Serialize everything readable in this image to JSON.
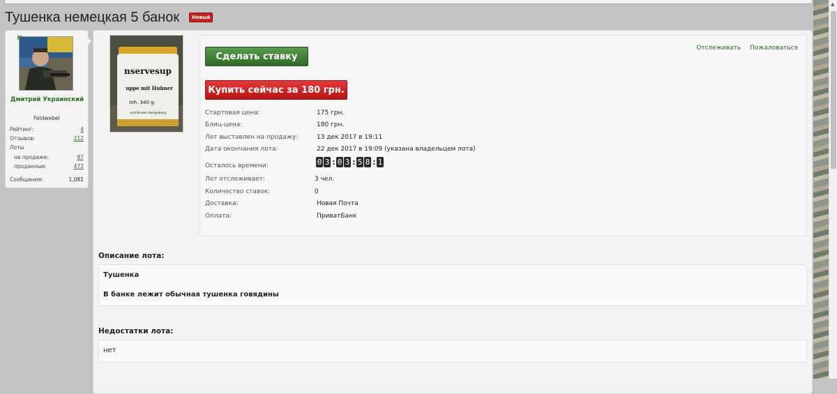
{
  "title": "Тушенка немецкая 5 банок",
  "badge": "Новый",
  "user": {
    "name": "Дмитрий Украинский",
    "rank": "Feldwebel",
    "stats": [
      {
        "label": "Рейтинг:",
        "value": "4"
      },
      {
        "label": "Отзывов:",
        "value": "212"
      },
      {
        "label": "Лоты",
        "value": ""
      },
      {
        "label": "на продаже:",
        "value": "87"
      },
      {
        "label": "проданные:",
        "value": "472"
      },
      {
        "label": "Сообщения:",
        "value": "1,081"
      }
    ]
  },
  "lot_image": {
    "label_line1": "nservesup",
    "label_line2": "uppe mit Huhner",
    "label_line3": "Inh. 340 g.",
    "label_line4": "und Bruder Konigsberg"
  },
  "actions": {
    "bid": "Сделать ставку",
    "buy": "Купить сейчас за 180 грн.",
    "watch": "Отслеживать",
    "report": "Пожаловаться"
  },
  "details": [
    {
      "label": "Стартовая цена:",
      "value": "175 грн."
    },
    {
      "label": "Блиц-цена:",
      "value": "180 грн."
    },
    {
      "label": "Лот выставлен на продажу:",
      "value": "13 дек 2017 в 19:11"
    },
    {
      "label": "Дата окончания лота:",
      "value": "22 дек 2017 в 19:09 (указана владельцем лота)"
    }
  ],
  "remaining": {
    "label": "Осталось времени:",
    "days": [
      "0",
      "3"
    ],
    "hours": [
      "0",
      "3"
    ],
    "minutes": [
      "5",
      "8"
    ],
    "seconds": "1"
  },
  "details2": [
    {
      "label": "Лот отслеживает:",
      "value": "3 чел."
    },
    {
      "label": "Количество ставок:",
      "value": "0"
    },
    {
      "label": "Доставка:",
      "value": "Новая Почта"
    },
    {
      "label": "Оплата:",
      "value": "ПриватБанк"
    }
  ],
  "description": {
    "title": "Описание лота:",
    "line1": "Тушенка",
    "line2": "В банке лежит обычная тушенка говядины"
  },
  "flaws": {
    "title": "Недостатки лота:",
    "text": "нет"
  },
  "colors": {
    "bid": "#3f7f35",
    "buy": "#c42222",
    "link": "#2f6b26"
  }
}
